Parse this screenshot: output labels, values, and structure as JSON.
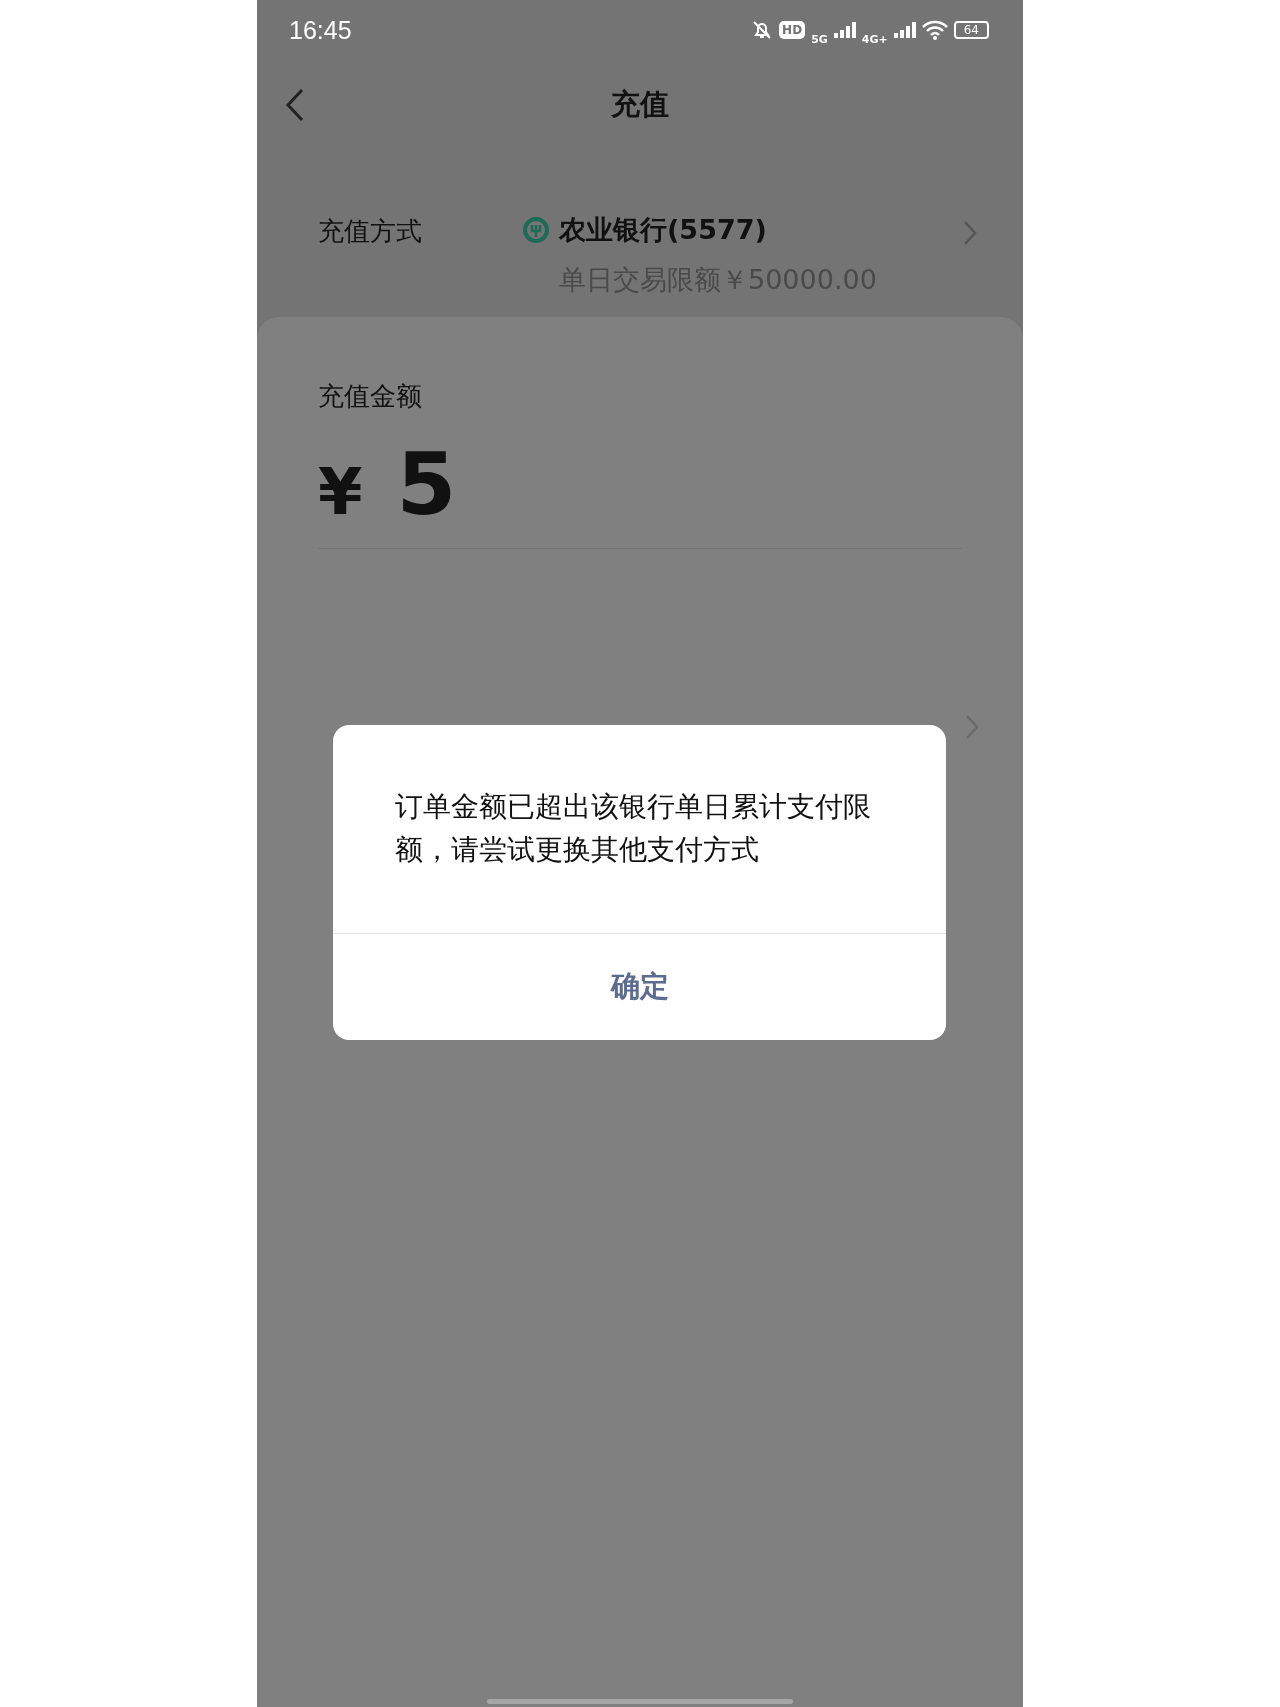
{
  "status_bar": {
    "time": "16:45",
    "hd_badge": "HD",
    "network_1": "5G",
    "network_2": "4G+",
    "battery": "64"
  },
  "nav": {
    "title": "充值"
  },
  "payment_method": {
    "label": "充值方式",
    "bank": "农业银行(5577)",
    "limit": "单日交易限额￥50000.00"
  },
  "amount": {
    "label": "充值金额",
    "currency": "¥",
    "value": "5"
  },
  "dialog": {
    "message": "订单金额已超出该银行单日累计支付限额，请尝试更换其他支付方式",
    "button": "确定"
  }
}
